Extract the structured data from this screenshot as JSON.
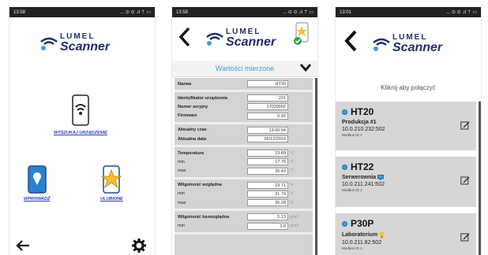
{
  "colors": {
    "brand": "#1f2f6b",
    "accent": "#3aa0e0",
    "favorite": "#f2c230",
    "panel": "#d6d6d6"
  },
  "screen1": {
    "status": {
      "time": "13:58",
      "icons": "... ⊙ ⊙ .ıl ⇡ ▭"
    },
    "logo": {
      "brand": "LUMEL",
      "product": "Scanner"
    },
    "search_label": "WYSZUKAJ URZĄDZENIE",
    "enter_label": "WPROWADŹ",
    "favorites_label": "ULUBIONE",
    "icons": {
      "back": "arrow-left-icon",
      "settings": "gear-icon"
    }
  },
  "screen2": {
    "status": {
      "time": "13:58",
      "icons": "... ⊙ ⊙ .ıl ⇡ ▭"
    },
    "logo": {
      "brand": "LUMEL",
      "product": "Scanner"
    },
    "section_title": "Wartości mierzone",
    "groups": [
      [
        {
          "label": "Nazwa",
          "bold": true,
          "value": "HT20",
          "unit": ""
        }
      ],
      [
        {
          "label": "Identyfikator urządzenia",
          "bold": true,
          "value": "221",
          "unit": ""
        },
        {
          "label": "Numer seryjny",
          "bold": true,
          "value": "17020002",
          "unit": ""
        },
        {
          "label": "Firmware",
          "bold": true,
          "value": "0.92",
          "unit": ""
        }
      ],
      [
        {
          "label": "Aktualny czas",
          "bold": true,
          "value": "13:06:54",
          "unit": ""
        },
        {
          "label": "Aktualna data",
          "bold": true,
          "value": "05/12/2019",
          "unit": ""
        }
      ],
      [
        {
          "label": "Temperatura",
          "bold": true,
          "value": "23.89",
          "unit": "°C"
        },
        {
          "label": "min",
          "bold": false,
          "value": "17.76",
          "unit": "°C"
        },
        {
          "label": "max",
          "bold": false,
          "value": "26.43",
          "unit": "°C"
        }
      ],
      [
        {
          "label": "Wilgotność względna",
          "bold": true,
          "value": "23.71",
          "unit": "%"
        },
        {
          "label": "min",
          "bold": false,
          "value": "21.79",
          "unit": "%"
        },
        {
          "label": "max",
          "bold": false,
          "value": "35.28",
          "unit": "%"
        }
      ],
      [
        {
          "label": "Wilgotność bezwzględna",
          "bold": true,
          "value": "5.13",
          "unit": "g/m3"
        },
        {
          "label": "min",
          "bold": false,
          "value": "3.8",
          "unit": "g/m3"
        }
      ]
    ]
  },
  "screen3": {
    "status": {
      "time": "13:01",
      "icons": "... ⊙ ⊙ .ıl ⇡ ▭"
    },
    "logo": {
      "brand": "LUMEL",
      "product": "Scanner"
    },
    "hint": "Kliknij aby połączyć",
    "devices": [
      {
        "name": "HT20",
        "location": "Produkcja #1",
        "ip": "10.0.210.232:502",
        "protocol": "Modbus ID 1",
        "badge": ""
      },
      {
        "name": "HT22",
        "location": "Serwerownia",
        "ip": "10.0.211.241:502",
        "protocol": "Modbus ID 1",
        "badge": "monitor-icon"
      },
      {
        "name": "P30P",
        "location": "Laboratorium",
        "ip": "10.0.211.82:502",
        "protocol": "Modbus ID 1",
        "badge": "lightbulb-icon"
      }
    ]
  }
}
